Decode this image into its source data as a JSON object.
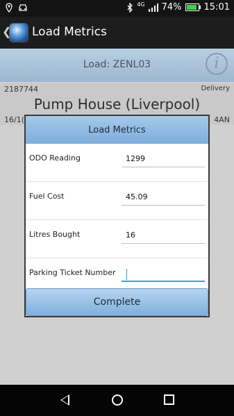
{
  "status_bar": {
    "network": "4G",
    "battery": "74%",
    "time": "15:01"
  },
  "app_bar": {
    "title": "Load Metrics"
  },
  "load": {
    "label": "Load: ZENL03"
  },
  "job": {
    "number": "2187744",
    "type": "Delivery",
    "name": "Pump House (Liverpool)",
    "date_partial": "16/1(",
    "code_partial": "4AN"
  },
  "dialog": {
    "title": "Load Metrics",
    "fields": [
      {
        "label": "ODO Reading",
        "value": "1299"
      },
      {
        "label": "Fuel Cost",
        "value": "45.09"
      },
      {
        "label": "Litres Bought",
        "value": "16"
      },
      {
        "label": "Parking Ticket Number",
        "value": ""
      }
    ],
    "complete_label": "Complete"
  }
}
